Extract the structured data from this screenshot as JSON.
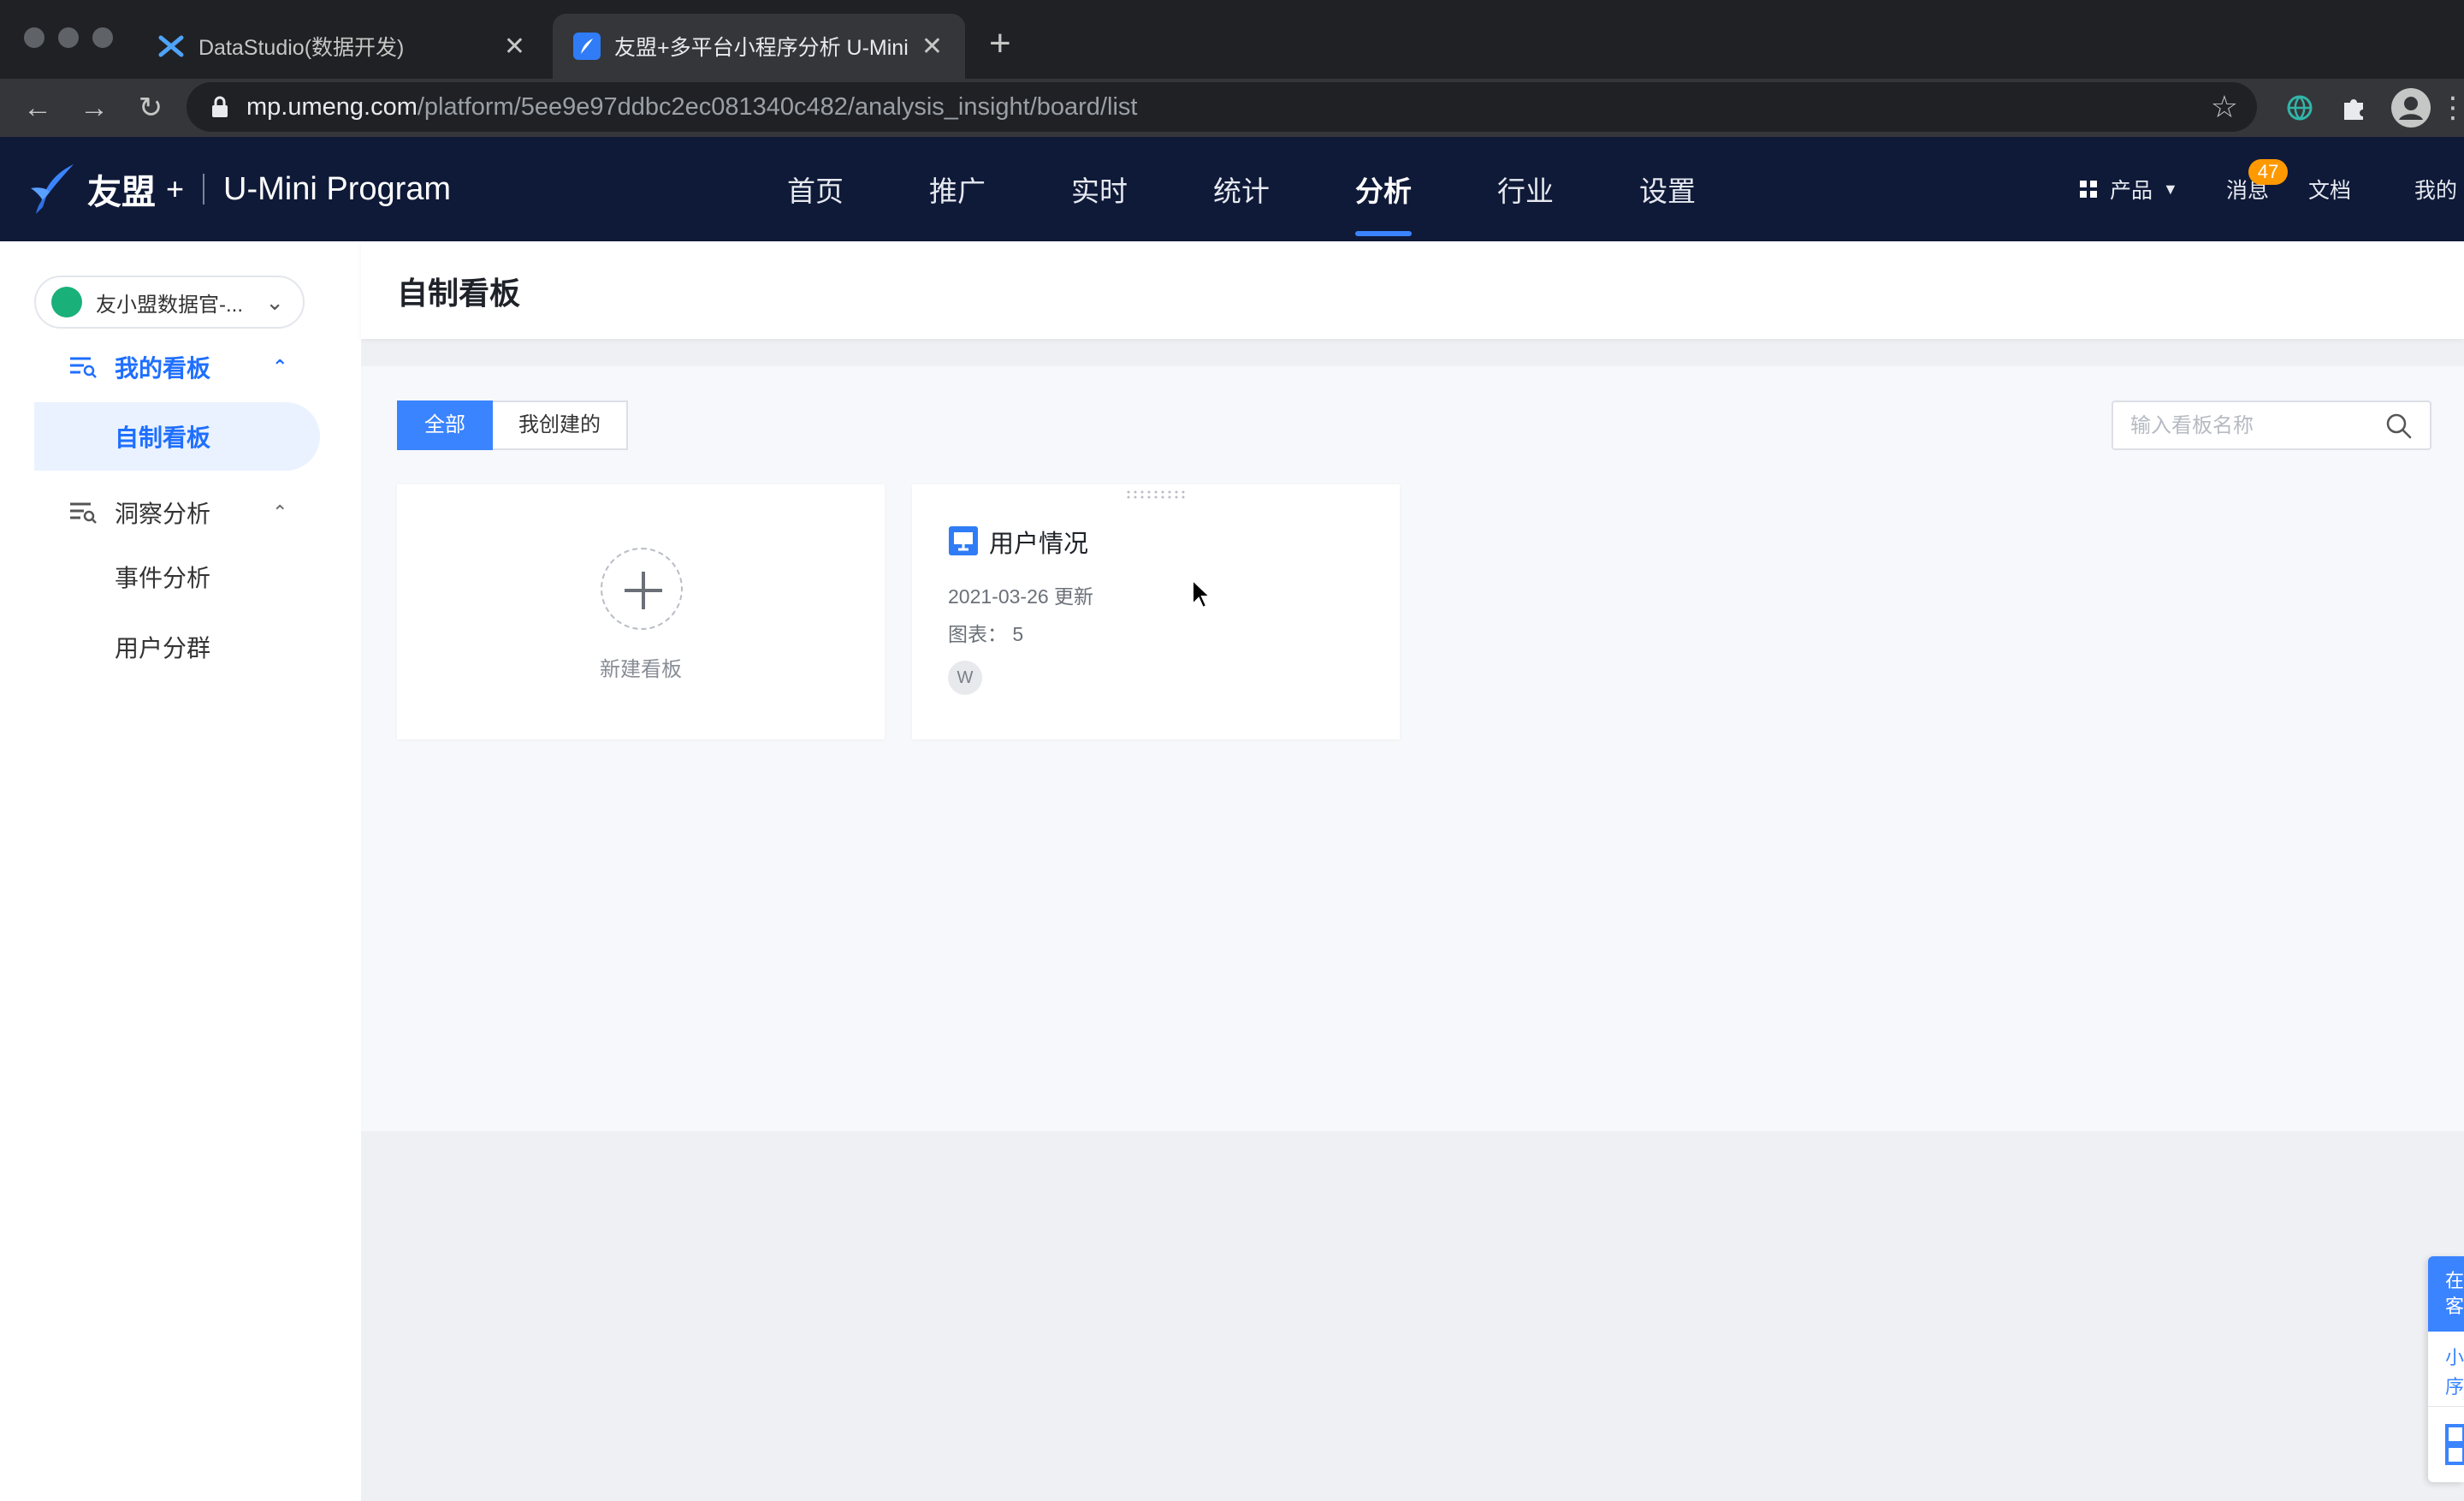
{
  "browser": {
    "tabs": [
      {
        "title": "DataStudio(数据开发)",
        "active": false
      },
      {
        "title": "友盟+多平台小程序分析 U-Mini",
        "active": true
      }
    ],
    "url_host": "mp.umeng.com",
    "url_path": "/platform/5ee9e97ddbc2ec081340c482/analysis_insight/board/list"
  },
  "header": {
    "brand_cn": "友盟",
    "brand_plus": "+",
    "product": "U-Mini Program",
    "nav": [
      "首页",
      "推广",
      "实时",
      "统计",
      "分析",
      "行业",
      "设置"
    ],
    "active_nav": "分析",
    "products_label": "产品",
    "messages_label": "消息",
    "messages_count": "47",
    "docs_label": "文档",
    "mine_label": "我的"
  },
  "sidebar": {
    "app_name": "友小盟数据官-...",
    "groups": [
      {
        "label": "我的看板",
        "open": true,
        "items": [
          "自制看板"
        ]
      },
      {
        "label": "洞察分析",
        "open": false,
        "items": [
          "事件分析",
          "用户分群"
        ]
      }
    ],
    "active_item": "自制看板"
  },
  "main": {
    "title": "自制看板",
    "filters": [
      "全部",
      "我创建的"
    ],
    "active_filter": "全部",
    "search_placeholder": "输入看板名称",
    "new_board_label": "新建看板",
    "boards": [
      {
        "name": "用户情况",
        "updated": "2021-03-26 更新",
        "charts": "图表：  5",
        "owner_initial": "W"
      }
    ]
  },
  "float_widget": {
    "top_text": "在\n客",
    "mid_text": "小\n序"
  },
  "colors": {
    "header_bg": "#0f1a38",
    "accent": "#3a84ff",
    "badge": "#ff9900",
    "sidebar_active_bg": "#eaf2ff"
  }
}
